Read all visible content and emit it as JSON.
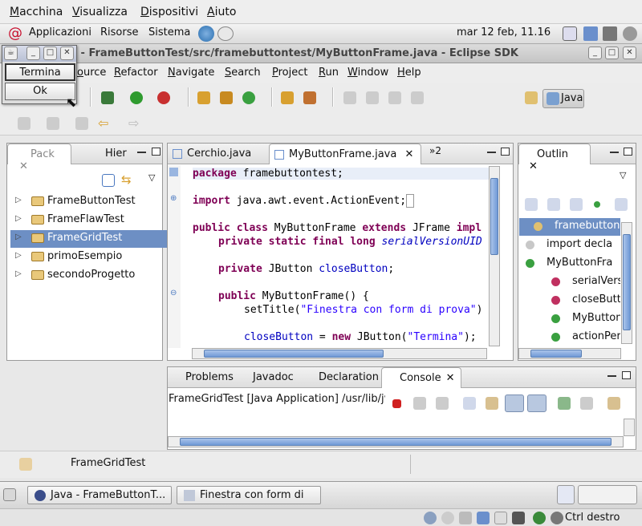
{
  "vm_menu": [
    "Macchina",
    "Visualizza",
    "Dispositivi",
    "Aiuto"
  ],
  "gnome_panel": {
    "items": [
      "Applicazioni",
      "Risorse",
      "Sistema"
    ],
    "clock": "mar 12 feb, 11.16"
  },
  "window": {
    "title": "ava - FrameButtonTest/src/framebuttontest/MyButtonFrame.java - Eclipse SDK"
  },
  "menubar": [
    "ource",
    "Refactor",
    "Navigate",
    "Search",
    "Project",
    "Run",
    "Window",
    "Help"
  ],
  "perspective": {
    "label": "Java"
  },
  "package_explorer": {
    "tabs": [
      "Pack",
      "Hier"
    ],
    "items": [
      {
        "label": "FrameButtonTest",
        "selected": false
      },
      {
        "label": "FrameFlawTest",
        "selected": false
      },
      {
        "label": "FrameGridTest",
        "selected": true
      },
      {
        "label": "primoEsempio",
        "selected": false
      },
      {
        "label": "secondoProgetto",
        "selected": false
      }
    ]
  },
  "editor": {
    "tabs": [
      "Cerchio.java",
      "MyButtonFrame.java",
      "»2"
    ],
    "lines": {
      "l1_kw": "package",
      "l1_rest": " framebuttontest;",
      "l2_kw": "import",
      "l2_rest": " java.awt.event.ActionEvent;",
      "l3_kw1": "public class",
      "l3_mid": " MyButtonFrame ",
      "l3_kw2": "extends",
      "l3_rest": " JFrame ",
      "l3_kw3": "impl",
      "l4_kw": "private static final long",
      "l4_field": "serialVersionUID",
      "l5_kw": "private",
      "l5_rest": " JButton ",
      "l5_field": "closeButton",
      "l5_end": ";",
      "l6_kw": "public",
      "l6_rest": " MyButtonFrame() {",
      "l7_a": "setTitle(",
      "l7_str": "\"Finestra con form di prova\"",
      "l7_b": ")",
      "l8_field": "closeButton",
      "l8_a": " = ",
      "l8_kw": "new",
      "l8_b": " JButton(",
      "l8_str": "\"Termina\"",
      "l8_c": ");"
    }
  },
  "outline": {
    "tab": "Outlin",
    "items": [
      "framebutton",
      "import decla",
      "MyButtonFra",
      "serialVers",
      "closeButt",
      "MyButton",
      "actionPer"
    ]
  },
  "bottom_panel": {
    "tabs": [
      "Problems",
      "Javadoc",
      "Declaration",
      "Console"
    ],
    "console_header": "FrameGridTest [Java Application] /usr/lib/jvı"
  },
  "status": {
    "text": "FrameGridTest"
  },
  "taskbar": {
    "tasks": [
      "Java - FrameButtonT...",
      "Finestra con form di ..."
    ]
  },
  "vbox_status": {
    "ctrl": "Ctrl destro"
  },
  "dialog": {
    "buttons": [
      "Termina",
      "Ok"
    ]
  }
}
